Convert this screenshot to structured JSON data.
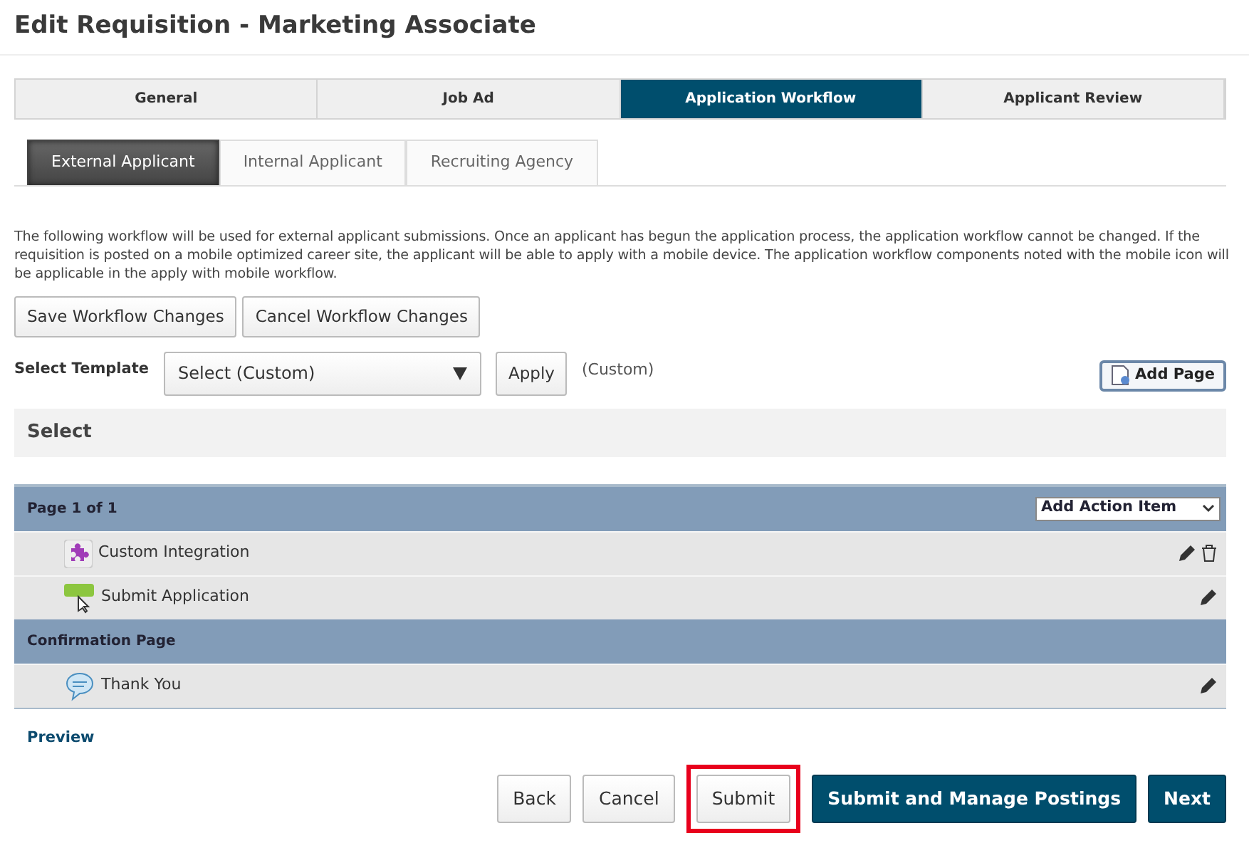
{
  "page_title": "Edit Requisition - Marketing Associate",
  "main_tabs": [
    {
      "label": "General",
      "selected": false
    },
    {
      "label": "Job Ad",
      "selected": false
    },
    {
      "label": "Application Workflow",
      "selected": true
    },
    {
      "label": "Applicant Review",
      "selected": false
    }
  ],
  "sub_tabs": [
    {
      "label": "External Applicant",
      "selected": true
    },
    {
      "label": "Internal Applicant",
      "selected": false
    },
    {
      "label": "Recruiting Agency",
      "selected": false
    }
  ],
  "description": "The following workflow will be used for external applicant submissions. Once an applicant has begun the application process, the application workflow cannot be changed. If the requisition is posted on a mobile optimized career site, the applicant will be able to apply with a mobile device. The application workflow components noted with the mobile icon will be applicable in the apply with mobile workflow.",
  "workflow_buttons": [
    "Save Workflow Changes",
    "Cancel Workflow Changes"
  ],
  "template": {
    "label": "Select Template",
    "value": "Select (Custom)",
    "apply": "Apply",
    "note": "(Custom)"
  },
  "add_page": "Add Page",
  "select_header": "Select",
  "sections": [
    {
      "title": "Page 1 of 1",
      "action_select": "Add Action Item",
      "items": [
        {
          "kind": "integration",
          "label": "Custom Integration",
          "deletable": true
        },
        {
          "kind": "submit",
          "label": "Submit Application",
          "deletable": false
        }
      ]
    },
    {
      "title": "Confirmation Page",
      "items": [
        {
          "kind": "message",
          "label": "Thank You",
          "deletable": false
        }
      ]
    }
  ],
  "preview_link": "Preview",
  "footer_buttons": [
    {
      "label": "Back",
      "kind": "default",
      "highlighted": false
    },
    {
      "label": "Cancel",
      "kind": "default",
      "highlighted": false
    },
    {
      "label": "Submit",
      "kind": "default",
      "highlighted": true
    },
    {
      "label": "Submit and Manage Postings",
      "kind": "primary",
      "highlighted": false
    },
    {
      "label": "Next",
      "kind": "primary",
      "highlighted": false
    }
  ]
}
